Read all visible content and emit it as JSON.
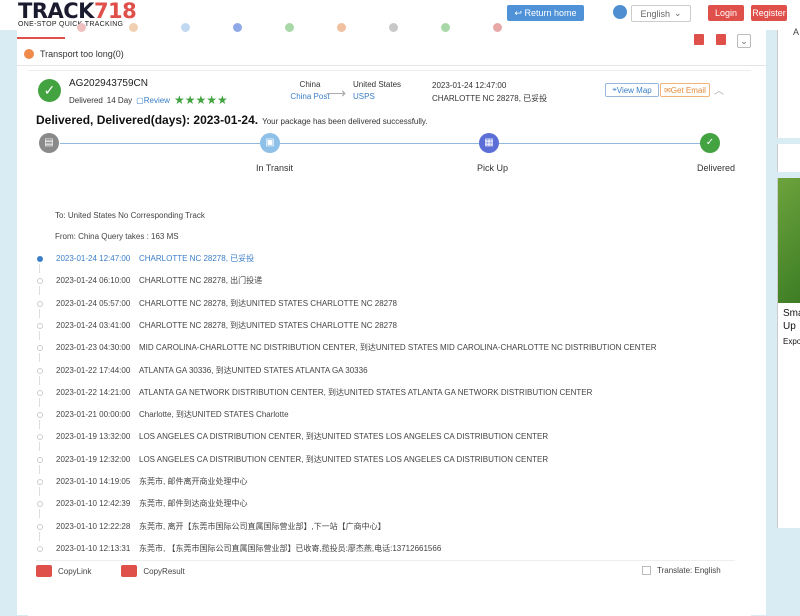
{
  "header": {
    "logo_main": "TRACK",
    "logo_num": "718",
    "logo_tagline": "ONE-STOP QUICK TRACKING",
    "return_label": "Return home",
    "language": "English",
    "login_label": "Login",
    "register_label": "Register"
  },
  "sidebar": {
    "panel_text": "A",
    "ad_title_line1": "Sma",
    "ad_title_line2": "Up",
    "ad_sub": "Expo"
  },
  "filter": {
    "too_long_label": "Transport too long(0)"
  },
  "shipment": {
    "tracking_number": "AG202943759CN",
    "status": "Delivered",
    "days": "14 Day",
    "review_label": "Review",
    "stars": "★★★★★",
    "origin_country": "China",
    "origin_carrier": "China Post",
    "dest_country": "United States",
    "dest_carrier": "USPS",
    "latest_time": "2023-01-24 12:47:00",
    "latest_location": "CHARLOTTE NC 28278, 已妥投",
    "view_map_label": "View Map",
    "get_email_label": "Get Email",
    "headline": "Delivered, Delivered(days): 2023-01-24.",
    "headline_sub": "Your package has been delivered successfully.",
    "to_line": "To: United States   No Corresponding Track",
    "from_line": "From: China   Query takes : 163 MS"
  },
  "progress": {
    "stages": [
      "",
      "In Transit",
      "Pick Up",
      "Delivered"
    ],
    "colors": {
      "start": "#8a8a8a",
      "transit": "#8fc0e8",
      "pickup": "#5b6fd6",
      "delivered": "#43a340"
    }
  },
  "events": [
    {
      "time": "2023-01-24 12:47:00",
      "desc": "CHARLOTTE NC 28278, 已妥投"
    },
    {
      "time": "2023-01-24 06:10:00",
      "desc": "CHARLOTTE NC 28278, 出门投递"
    },
    {
      "time": "2023-01-24 05:57:00",
      "desc": "CHARLOTTE NC 28278, 到达UNITED STATES CHARLOTTE NC 28278"
    },
    {
      "time": "2023-01-24 03:41:00",
      "desc": "CHARLOTTE NC 28278, 到达UNITED STATES CHARLOTTE NC 28278"
    },
    {
      "time": "2023-01-23 04:30:00",
      "desc": "MID CAROLINA-CHARLOTTE NC DISTRIBUTION CENTER, 到达UNITED STATES MID CAROLINA-CHARLOTTE NC DISTRIBUTION CENTER"
    },
    {
      "time": "2023-01-22 17:44:00",
      "desc": "ATLANTA GA 30336, 到达UNITED STATES ATLANTA GA 30336"
    },
    {
      "time": "2023-01-22 14:21:00",
      "desc": "ATLANTA GA NETWORK DISTRIBUTION CENTER, 到达UNITED STATES ATLANTA GA NETWORK DISTRIBUTION CENTER"
    },
    {
      "time": "2023-01-21 00:00:00",
      "desc": "Charlotte, 到达UNITED STATES Charlotte"
    },
    {
      "time": "2023-01-19 13:32:00",
      "desc": "LOS ANGELES CA DISTRIBUTION CENTER, 到达UNITED STATES LOS ANGELES CA DISTRIBUTION CENTER"
    },
    {
      "time": "2023-01-19 12:32:00",
      "desc": "LOS ANGELES CA DISTRIBUTION CENTER, 到达UNITED STATES LOS ANGELES CA DISTRIBUTION CENTER"
    },
    {
      "time": "2023-01-10 14:19:05",
      "desc": "东莞市, 邮件离开商业处理中心"
    },
    {
      "time": "2023-01-10 12:42:39",
      "desc": "东莞市, 邮件到达商业处理中心"
    },
    {
      "time": "2023-01-10 12:22:28",
      "desc": "东莞市, 离开【东莞市国际公司直属国际营业部】,下一站【广商中心】"
    },
    {
      "time": "2023-01-10 12:13:31",
      "desc": "东莞市, 【东莞市国际公司直属国际营业部】已收寄,揽投员:廖杰燕,电话:13712661566"
    }
  ],
  "footer": {
    "copy_link_label": "CopyLink",
    "copy_result_label": "CopyResult",
    "translate_label": "Translate: English"
  }
}
